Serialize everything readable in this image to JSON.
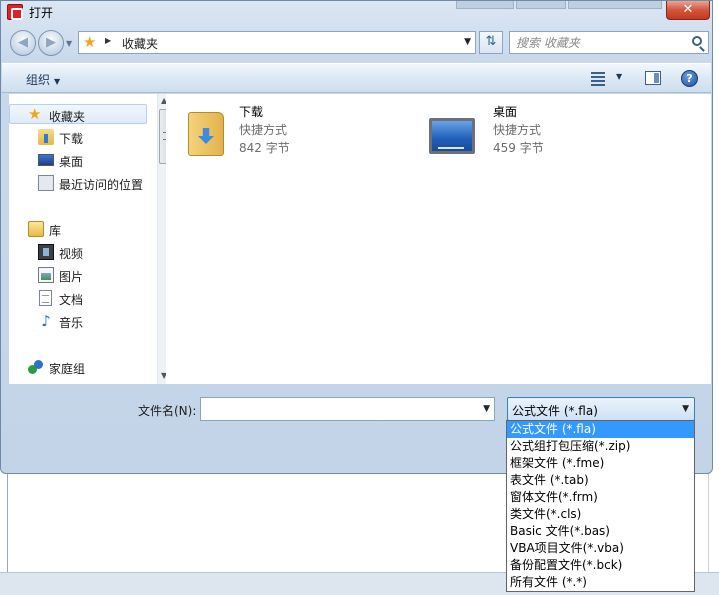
{
  "window": {
    "title": "打开",
    "close_label": "✕"
  },
  "address": {
    "path": "收藏夹",
    "search_placeholder": "搜索 收藏夹"
  },
  "toolbar": {
    "organize_label": "组织",
    "help_label": "?"
  },
  "nav": {
    "favorites": {
      "label": "收藏夹",
      "items": [
        {
          "label": "下载",
          "icon": "download-folder-icon"
        },
        {
          "label": "桌面",
          "icon": "desktop-icon"
        },
        {
          "label": "最近访问的位置",
          "icon": "recent-places-icon"
        }
      ]
    },
    "library": {
      "label": "库",
      "items": [
        {
          "label": "视频",
          "icon": "video-icon"
        },
        {
          "label": "图片",
          "icon": "picture-icon"
        },
        {
          "label": "文档",
          "icon": "document-icon"
        },
        {
          "label": "音乐",
          "icon": "music-icon"
        }
      ]
    },
    "homegroup": {
      "label": "家庭组",
      "icon": "homegroup-icon"
    }
  },
  "files": [
    {
      "name": "下载",
      "type": "快捷方式",
      "size": "842 字节",
      "icon": "download-folder-icon"
    },
    {
      "name": "桌面",
      "type": "快捷方式",
      "size": "459 字节",
      "icon": "desktop-icon"
    }
  ],
  "bottom": {
    "filename_label": "文件名(N):",
    "filename_value": "",
    "filetype_selected": "公式文件 (*.fla)"
  },
  "filetype_options": [
    "公式文件 (*.fla)",
    "公式组打包压缩(*.zip)",
    "框架文件 (*.fme)",
    "表文件 (*.tab)",
    "窗体文件(*.frm)",
    "类文件(*.cls)",
    "Basic 文件(*.bas)",
    "VBA项目文件(*.vba)",
    "备份配置文件(*.bck)",
    "所有文件 (*.*)"
  ],
  "colors": {
    "selection": "#3399ff",
    "titlebar": "#c9d9ec",
    "close_button": "#c7371d"
  }
}
